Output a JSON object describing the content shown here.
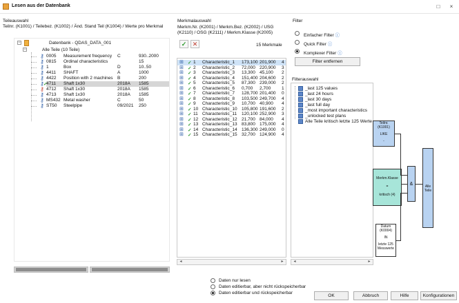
{
  "window": {
    "title": "Lesen aus der Datenbank",
    "buttons": [
      "□",
      "×"
    ]
  },
  "teileauswahl": {
    "heading": "Teileauswahl",
    "columns_info": "Teilnr. (K1001) / Teilebez. (K1002) / Änd. Stand Teil (K1004) / Werte pro Merkmal",
    "database_label": "Datenbank - QDAS_DATA_001",
    "group_label": "Alle Teile (10 Teile)",
    "parts": [
      {
        "nr": "0005",
        "name": "Measurement frequency",
        "rev": "C",
        "val": "930..2000",
        "key": "blue"
      },
      {
        "nr": "0815",
        "name": "Ordinal characteristics",
        "rev": "",
        "val": "15",
        "key": "blue"
      },
      {
        "nr": "1",
        "name": "Box",
        "rev": "D",
        "val": "10..50",
        "key": "blue"
      },
      {
        "nr": "4411",
        "name": "SHAFT",
        "rev": "A",
        "val": "1000",
        "key": "blue"
      },
      {
        "nr": "4422",
        "name": "Position with 2 machines",
        "rev": "B",
        "val": "200",
        "key": "blue"
      },
      {
        "nr": "4711",
        "name": "Shaft 1x30",
        "rev": "2018A",
        "val": "1585",
        "key": "green",
        "selected": true
      },
      {
        "nr": "4712",
        "name": "Shaft 1x30",
        "rev": "2018A",
        "val": "1585",
        "key": "red"
      },
      {
        "nr": "4713",
        "name": "Shaft 1x30",
        "rev": "2018A",
        "val": "1585",
        "key": "blue"
      },
      {
        "nr": "MS432",
        "name": "Metal washer",
        "rev": "C",
        "val": "50",
        "key": "blue"
      },
      {
        "nr": "ST50",
        "name": "Steelpipe",
        "rev": "09/2021",
        "val": "250",
        "key": "blue"
      }
    ]
  },
  "merkmalauswahl": {
    "heading": "Merkmalauswahl",
    "columns_info_1": "Merkm.Nr. (K2001) / Merkm.Bez. (K2002) / USG",
    "columns_info_2": "(K2110) / OSG (K2111) / Merkm.Klasse (K2005)",
    "count_label": "15 Merkmale",
    "check_button": "✓",
    "cross_button": "✕",
    "items": [
      {
        "no": "1",
        "name": "Characteristic_1",
        "usg": "173,100",
        "osg": "201,900",
        "cls": "4",
        "selected": true
      },
      {
        "no": "2",
        "name": "Characteristic_2",
        "usg": "72,000",
        "osg": "220,900",
        "cls": "3"
      },
      {
        "no": "3",
        "name": "Characteristic_3",
        "usg": "13,300",
        "osg": "45,100",
        "cls": "2"
      },
      {
        "no": "4",
        "name": "Characteristic_4",
        "usg": "151,400",
        "osg": "204,600",
        "cls": "2"
      },
      {
        "no": "5",
        "name": "Characteristic_5",
        "usg": "87,300",
        "osg": "239,000",
        "cls": "2"
      },
      {
        "no": "6",
        "name": "Characteristic_6",
        "usg": "0,700",
        "osg": "2,700",
        "cls": "1"
      },
      {
        "no": "7",
        "name": "Characteristic_7",
        "usg": "128,700",
        "osg": "201,400",
        "cls": "0"
      },
      {
        "no": "8",
        "name": "Characteristic_8",
        "usg": "103,500",
        "osg": "249,700",
        "cls": "4"
      },
      {
        "no": "9",
        "name": "Characteristic_9",
        "usg": "10,700",
        "osg": "40,900",
        "cls": "4"
      },
      {
        "no": "10",
        "name": "Characteristic_10",
        "usg": "105,800",
        "osg": "191,600",
        "cls": "2"
      },
      {
        "no": "11",
        "name": "Characteristic_11",
        "usg": "120,100",
        "osg": "252,900",
        "cls": "3"
      },
      {
        "no": "12",
        "name": "Characteristic_12",
        "usg": "21,700",
        "osg": "84,000",
        "cls": "4"
      },
      {
        "no": "13",
        "name": "Characteristic_13",
        "usg": "83,800",
        "osg": "175,000",
        "cls": "4"
      },
      {
        "no": "14",
        "name": "Characteristic_14",
        "usg": "136,300",
        "osg": "249,000",
        "cls": "0"
      },
      {
        "no": "15",
        "name": "Characteristic_15",
        "usg": "32,700",
        "osg": "124,900",
        "cls": "4"
      }
    ]
  },
  "filter": {
    "heading": "Filter",
    "options": [
      {
        "label": "Einfacher Filter",
        "checked": false
      },
      {
        "label": "Quick Filter",
        "checked": false
      },
      {
        "label": "Komplexer Filter",
        "checked": true
      }
    ],
    "remove_button": "Filter entfernen",
    "filterauswahl_heading": "Filterauswahl",
    "items": [
      "_last 125 values",
      "_last 24 hours",
      "_last 30 days",
      "_last full day",
      "_most important characteristics",
      "_unlocked test plans",
      "Alle Teile kritisch letzte 125 Werte"
    ]
  },
  "flow": {
    "box1_lines": [
      "Teilnr.",
      "(K1001)",
      "",
      "LIKE",
      "",
      "-"
    ],
    "box2_lines": [
      "Merkm.Klasse",
      "",
      "=",
      "",
      "kritisch (4)"
    ],
    "box3_lines": [
      "Datum",
      "(K0004)",
      "",
      "IN",
      "",
      "letzte 125",
      "Messwerte"
    ],
    "and_label": "&",
    "result_label": "Alle Teile"
  },
  "bottom": {
    "options": [
      {
        "label": "Daten nur lesen",
        "checked": false
      },
      {
        "label": "Daten editierbar, aber nicht rückspeicherbar",
        "checked": false
      },
      {
        "label": "Daten editierbar und rückspeicherbar",
        "checked": true
      }
    ],
    "buttons": {
      "ok": "OK",
      "cancel": "Abbruch",
      "help": "Hilfe",
      "config": "Konfigurationen"
    }
  }
}
